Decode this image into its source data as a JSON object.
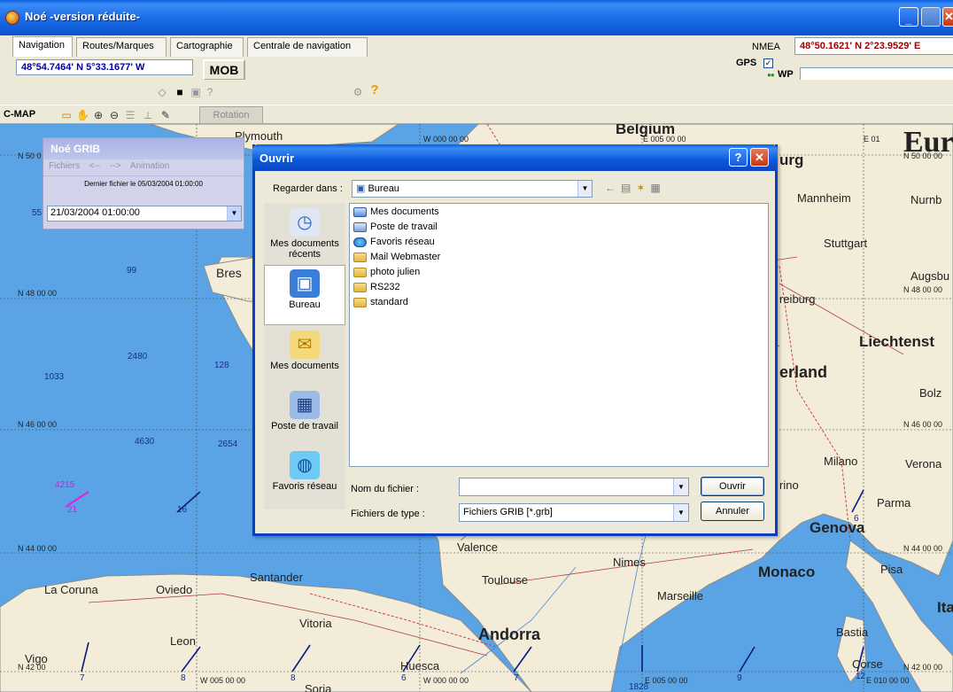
{
  "window": {
    "title": "Noé -version réduite-"
  },
  "tabs": [
    "Navigation",
    "Routes/Marques",
    "Cartographie",
    "Centrale de navigation"
  ],
  "nmea": {
    "label": "NMEA",
    "position": "48°50.1621' N   2°23.9529' E"
  },
  "current_position": "48°54.7464' N   5°33.1677' W",
  "mob_label": "MOB",
  "gps": {
    "label": "GPS",
    "checked": true,
    "wp_label": "WP",
    "wp_value": ""
  },
  "cmap": {
    "label": "C-MAP",
    "rotation_label": "Rotation"
  },
  "grib_window": {
    "title": "Noé GRIB",
    "menu": [
      "Fichiers",
      "<--",
      "-->",
      "Animation"
    ],
    "last_file": "Dernier fichier le 05/03/2004 01:00:00",
    "selected_date": "21/03/2004 01:00:00"
  },
  "dialog": {
    "title": "Ouvrir",
    "look_in_label": "Regarder dans :",
    "look_in_value": "Bureau",
    "places": [
      {
        "label": "Mes documents récents",
        "icon": "recent-documents-icon"
      },
      {
        "label": "Bureau",
        "icon": "desktop-icon"
      },
      {
        "label": "Mes documents",
        "icon": "my-documents-icon"
      },
      {
        "label": "Poste de travail",
        "icon": "my-computer-icon"
      },
      {
        "label": "Favoris réseau",
        "icon": "network-places-icon"
      }
    ],
    "files": [
      {
        "name": "Mes documents",
        "type": "folder"
      },
      {
        "name": "Poste de travail",
        "type": "computer"
      },
      {
        "name": "Favoris réseau",
        "type": "network"
      },
      {
        "name": "Mail Webmaster",
        "type": "folder"
      },
      {
        "name": "photo julien",
        "type": "folder"
      },
      {
        "name": "RS232",
        "type": "folder"
      },
      {
        "name": "standard",
        "type": "folder"
      }
    ],
    "filename_label": "Nom du fichier :",
    "filename_value": "",
    "filetype_label": "Fichiers de type :",
    "filetype_value": "Fichiers GRIB [*.grb]",
    "open_button": "Ouvrir",
    "cancel_button": "Annuler"
  },
  "map": {
    "place_labels": {
      "plymouth": "Plymouth",
      "belgium": "Belgium",
      "europe": "Euro",
      "burg": "urg",
      "mannheim": "Mannheim",
      "nurnberg": "Nurnb",
      "stuttgart": "Stuttgart",
      "augsburg": "Augsbu",
      "brest": "Bres",
      "freiburg": "reiburg",
      "liechtenstein": "Liechtenst",
      "switzerland": "erland",
      "bolzano": "Bolz",
      "milano": "Milano",
      "verona": "Verona",
      "torino": "rino",
      "parma": "Parma",
      "genova": "Genova",
      "valence": "Valence",
      "nimes": "Nimes",
      "monaco": "Monaco",
      "pisa": "Pisa",
      "toulouse": "Toulouse",
      "marseille": "Marseille",
      "ita": "Ita",
      "la_coruna": "La Coruna",
      "oviedo": "Oviedo",
      "santander": "Santander",
      "vitoria": "Vitoria",
      "andorra": "Andorra",
      "bastia": "Bastia",
      "leon": "Leon",
      "vigo": "Vigo",
      "huesca": "Huesca",
      "corse": "Corse",
      "soria": "Soria"
    },
    "coordinate_labels": {
      "n50": "N 50 0",
      "n48": "N 48 00 00",
      "n46": "N 46 00 00",
      "n44": "N 44 00 00",
      "n42": "N 42 00",
      "w0": "W 000 00 00",
      "e5": "E 005 00 00",
      "e10": "E 010 00 00",
      "e01": "E 01",
      "n50r": "N 50 00 00",
      "n48r": "N 48 00 00",
      "n46r": "N 46 00 00",
      "n44r": "N 44 00 00",
      "n42r": "N 42 00 00",
      "w5": "W 005 00 00",
      "w0b": "W 000 00 00",
      "e5b": "E 005 00 00",
      "e10b": "E 010 00 00"
    },
    "grib_values": [
      "55",
      "99",
      "2480",
      "128",
      "1033",
      "4630",
      "2654",
      "4215",
      "21",
      "16",
      "6",
      "7",
      "8",
      "8",
      "6",
      "7",
      "9",
      "12",
      "1828"
    ]
  },
  "colors": {
    "xp_blue": "#0a5fe0",
    "sea": "#5aa4e5",
    "land": "#f3ecd9",
    "nmea_text": "#a00000",
    "current_pos_text": "#0000a0"
  }
}
